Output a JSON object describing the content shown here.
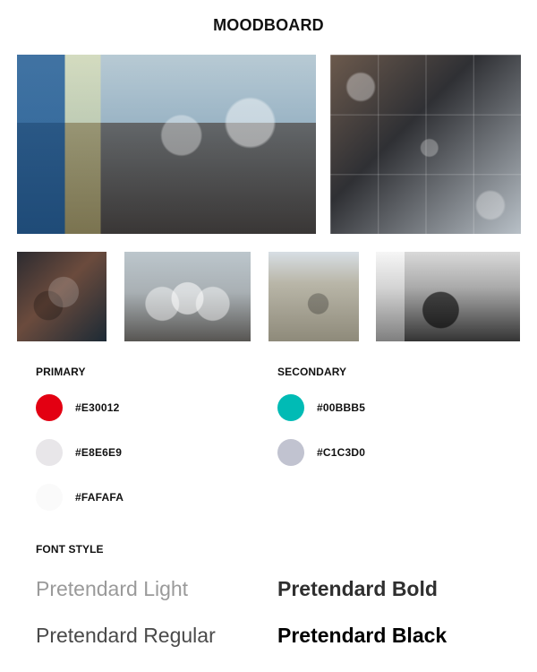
{
  "header": {
    "title": "MOODBOARD"
  },
  "palette": {
    "primary": {
      "label": "PRIMARY",
      "items": [
        {
          "hex": "#E30012"
        },
        {
          "hex": "#E8E6E9"
        },
        {
          "hex": "#FAFAFA"
        }
      ]
    },
    "secondary": {
      "label": "SECONDARY",
      "items": [
        {
          "hex": "#00BBB5"
        },
        {
          "hex": "#C1C3D0"
        }
      ]
    }
  },
  "font_style": {
    "label": "FONT STYLE",
    "samples": {
      "light": "Pretendard Light",
      "regular": "Pretendard Regular",
      "bold": "Pretendard Bold",
      "black": "Pretendard Black"
    }
  }
}
